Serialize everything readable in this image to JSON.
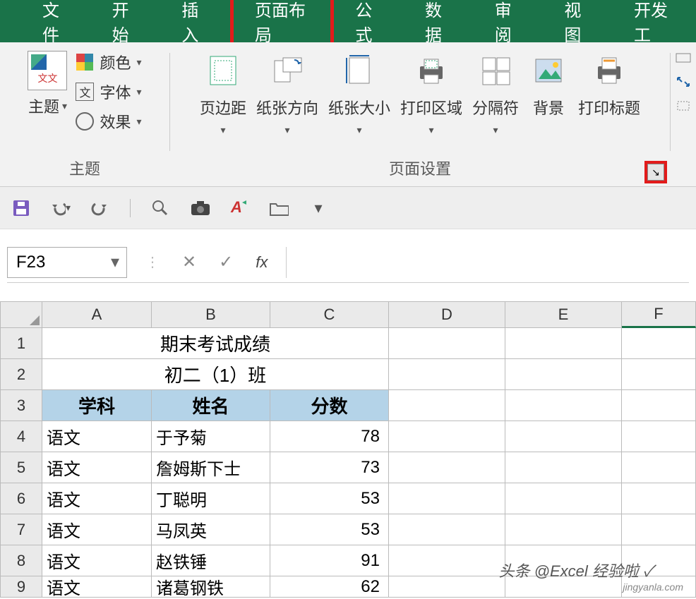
{
  "tabs": {
    "file": "文件",
    "home": "开始",
    "insert": "插入",
    "pagelayout": "页面布局",
    "formulas": "公式",
    "data": "数据",
    "review": "审阅",
    "view": "视图",
    "developer": "开发工"
  },
  "ribbon": {
    "themes": {
      "themes_label": "主题",
      "colors": "颜色",
      "fonts": "字体",
      "effects": "效果",
      "group_label": "主题"
    },
    "page_setup": {
      "margins": "页边距",
      "orientation": "纸张方向",
      "size": "纸张大小",
      "print_area": "打印区域",
      "breaks": "分隔符",
      "background": "背景",
      "print_titles": "打印标题",
      "group_label": "页面设置"
    }
  },
  "formula_bar": {
    "name_box": "F23",
    "fx": "fx"
  },
  "columns": [
    "A",
    "B",
    "C",
    "D",
    "E",
    "F"
  ],
  "rows": [
    "1",
    "2",
    "3",
    "4",
    "5",
    "6",
    "7",
    "8",
    "9"
  ],
  "sheet": {
    "title": "期末考试成绩",
    "subtitle": "初二（1）班",
    "headers": {
      "a": "学科",
      "b": "姓名",
      "c": "分数"
    },
    "data": [
      {
        "a": "语文",
        "b": "于予菊",
        "c": "78"
      },
      {
        "a": "语文",
        "b": "詹姆斯下士",
        "c": "73"
      },
      {
        "a": "语文",
        "b": "丁聪明",
        "c": "53"
      },
      {
        "a": "语文",
        "b": "马凤英",
        "c": "53"
      },
      {
        "a": "语文",
        "b": "赵铁锤",
        "c": "91"
      },
      {
        "a": "语文",
        "b": "诸葛钢铁",
        "c": "62"
      }
    ]
  },
  "watermark": "头条 @Excel 经验啦 ✓",
  "watermark_sub": "jingyanla.com"
}
